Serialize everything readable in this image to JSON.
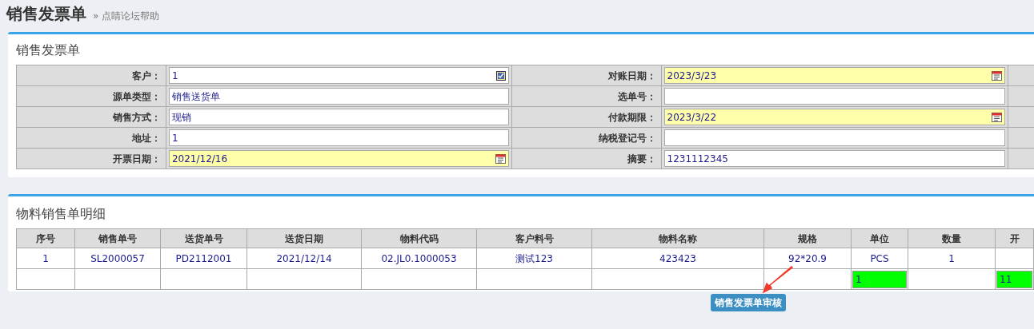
{
  "page": {
    "title": "销售发票单",
    "help_link": "» 点睛论坛帮助"
  },
  "header_panel": {
    "title": "销售发票单",
    "rows": [
      {
        "left": {
          "label": "客户：",
          "value": "1",
          "kind": "lookup"
        },
        "right": {
          "label": "对账日期：",
          "value": "2023/3/23",
          "kind": "date"
        }
      },
      {
        "left": {
          "label": "源单类型：",
          "value": "销售送货单",
          "kind": "text"
        },
        "right": {
          "label": "选单号：",
          "kind": "text"
        }
      },
      {
        "left": {
          "label": "销售方式：",
          "value": "现销",
          "kind": "text"
        },
        "right": {
          "label": "付款期限：",
          "value": "2023/3/22",
          "kind": "date"
        }
      },
      {
        "left": {
          "label": "地址：",
          "value": "1",
          "kind": "text"
        },
        "right": {
          "label": "纳税登记号：",
          "kind": "text"
        }
      },
      {
        "left": {
          "label": "开票日期：",
          "value": "2021/12/16",
          "kind": "date"
        },
        "right": {
          "label": "摘要：",
          "value": "1231112345",
          "kind": "text"
        }
      }
    ]
  },
  "detail_panel": {
    "title": "物料销售单明细",
    "columns": [
      "序号",
      "销售单号",
      "送货单号",
      "送货日期",
      "物料代码",
      "客户料号",
      "物料名称",
      "规格",
      "单位",
      "数量",
      "开"
    ],
    "rows": [
      [
        "1",
        "SL2000057",
        "PD2112001",
        "2021/12/14",
        "02.JL0.1000053",
        "测试123",
        "423423",
        "92*20.9",
        "PCS",
        "1",
        null
      ]
    ],
    "entry_row": [
      {
        "kind": "blank"
      },
      {
        "kind": "blank"
      },
      {
        "kind": "blank"
      },
      {
        "kind": "blank"
      },
      {
        "kind": "blank"
      },
      {
        "kind": "blank"
      },
      {
        "kind": "blank"
      },
      {
        "kind": "blank"
      },
      {
        "kind": "input",
        "value": "1"
      },
      {
        "kind": "blank"
      },
      {
        "kind": "input",
        "value": "11"
      }
    ]
  },
  "audit_button": "销售发票单审核"
}
